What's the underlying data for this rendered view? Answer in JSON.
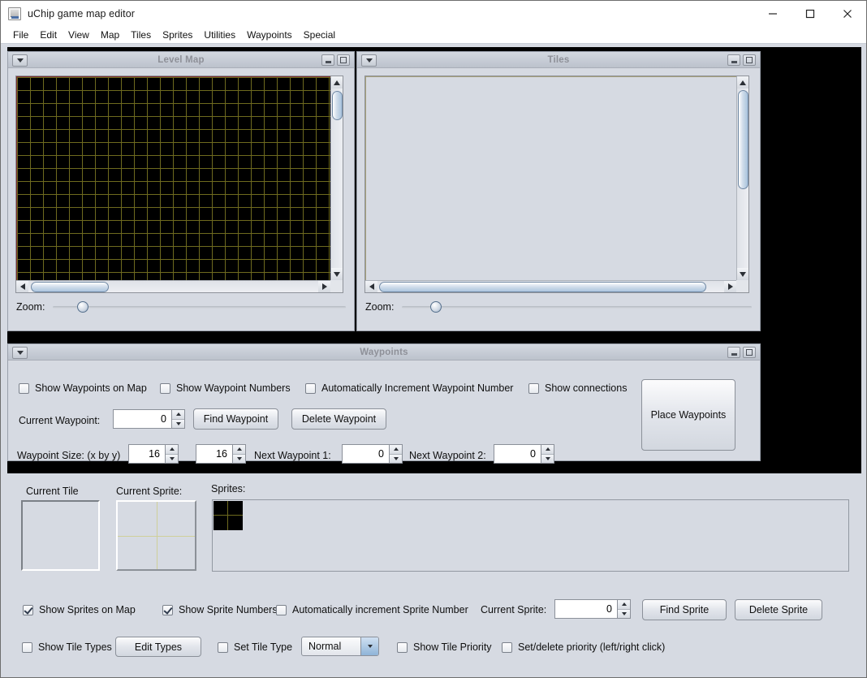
{
  "window": {
    "title": "uChip game map editor",
    "icon": "java-coffee-cup-icon",
    "minimize": "—",
    "maximize": "☐",
    "close": "✕"
  },
  "menubar": {
    "items": [
      {
        "label": "File"
      },
      {
        "label": "Edit"
      },
      {
        "label": "View"
      },
      {
        "label": "Map"
      },
      {
        "label": "Tiles"
      },
      {
        "label": "Sprites"
      },
      {
        "label": "Utilities"
      },
      {
        "label": "Waypoints"
      },
      {
        "label": "Special"
      }
    ]
  },
  "level_map_frame": {
    "title": "Level Map",
    "zoom_label": "Zoom:",
    "zoom_value": 10
  },
  "tiles_frame": {
    "title": "Tiles",
    "zoom_label": "Zoom:",
    "zoom_value": 10
  },
  "waypoints_frame": {
    "title": "Waypoints",
    "checkboxes": [
      {
        "label": "Show Waypoints on Map",
        "checked": false
      },
      {
        "label": "Show Waypoint Numbers",
        "checked": false
      },
      {
        "label": "Automatically Increment  Waypoint Number",
        "checked": false
      },
      {
        "label": "Show connections",
        "checked": false
      }
    ],
    "current_waypoint_label": "Current Waypoint:",
    "current_waypoint_value": "0",
    "find_waypoint_label": "Find Waypoint",
    "delete_waypoint_label": "Delete Waypoint",
    "place_waypoints_label": "Place Waypoints",
    "waypoint_size_label": "Waypoint Size: (x by y)",
    "waypoint_size_x": "16",
    "waypoint_size_y": "16",
    "next_waypoint_1_label": "Next Waypoint 1:",
    "next_waypoint_1_value": "0",
    "next_waypoint_2_label": "Next Waypoint 2:",
    "next_waypoint_2_value": "0"
  },
  "bottom_panel": {
    "current_tile_label": "Current Tile",
    "current_sprite_label": "Current Sprite:",
    "sprites_label": "Sprites:",
    "sprite_row": {
      "checkboxes": [
        {
          "label": "Show Sprites on Map",
          "checked": true
        },
        {
          "label": "Show Sprite Numbers",
          "checked": true
        },
        {
          "label": "Automatically increment Sprite Number",
          "checked": false
        }
      ],
      "current_sprite_label": "Current Sprite:",
      "current_sprite_value": "0",
      "find_sprite_label": "Find Sprite",
      "delete_sprite_label": "Delete Sprite"
    },
    "tile_row": {
      "show_tile_types": {
        "label": "Show Tile Types",
        "checked": false
      },
      "edit_types_label": "Edit Types",
      "set_tile_type": {
        "label": "Set Tile Type",
        "checked": false
      },
      "tile_type_selected": "Normal",
      "tile_type_options": [
        "Normal"
      ],
      "show_tile_priority": {
        "label": "Show Tile Priority",
        "checked": false
      },
      "set_delete_priority": {
        "label": "Set/delete priority (left/right click)",
        "checked": false
      }
    }
  },
  "colors": {
    "panel_bg": "#d6dae2",
    "desktop_bg": "#000000",
    "grid_minor": "#6e6a1f",
    "grid_major": "#7a2b2b",
    "frame_title_text": "#8e9098"
  }
}
